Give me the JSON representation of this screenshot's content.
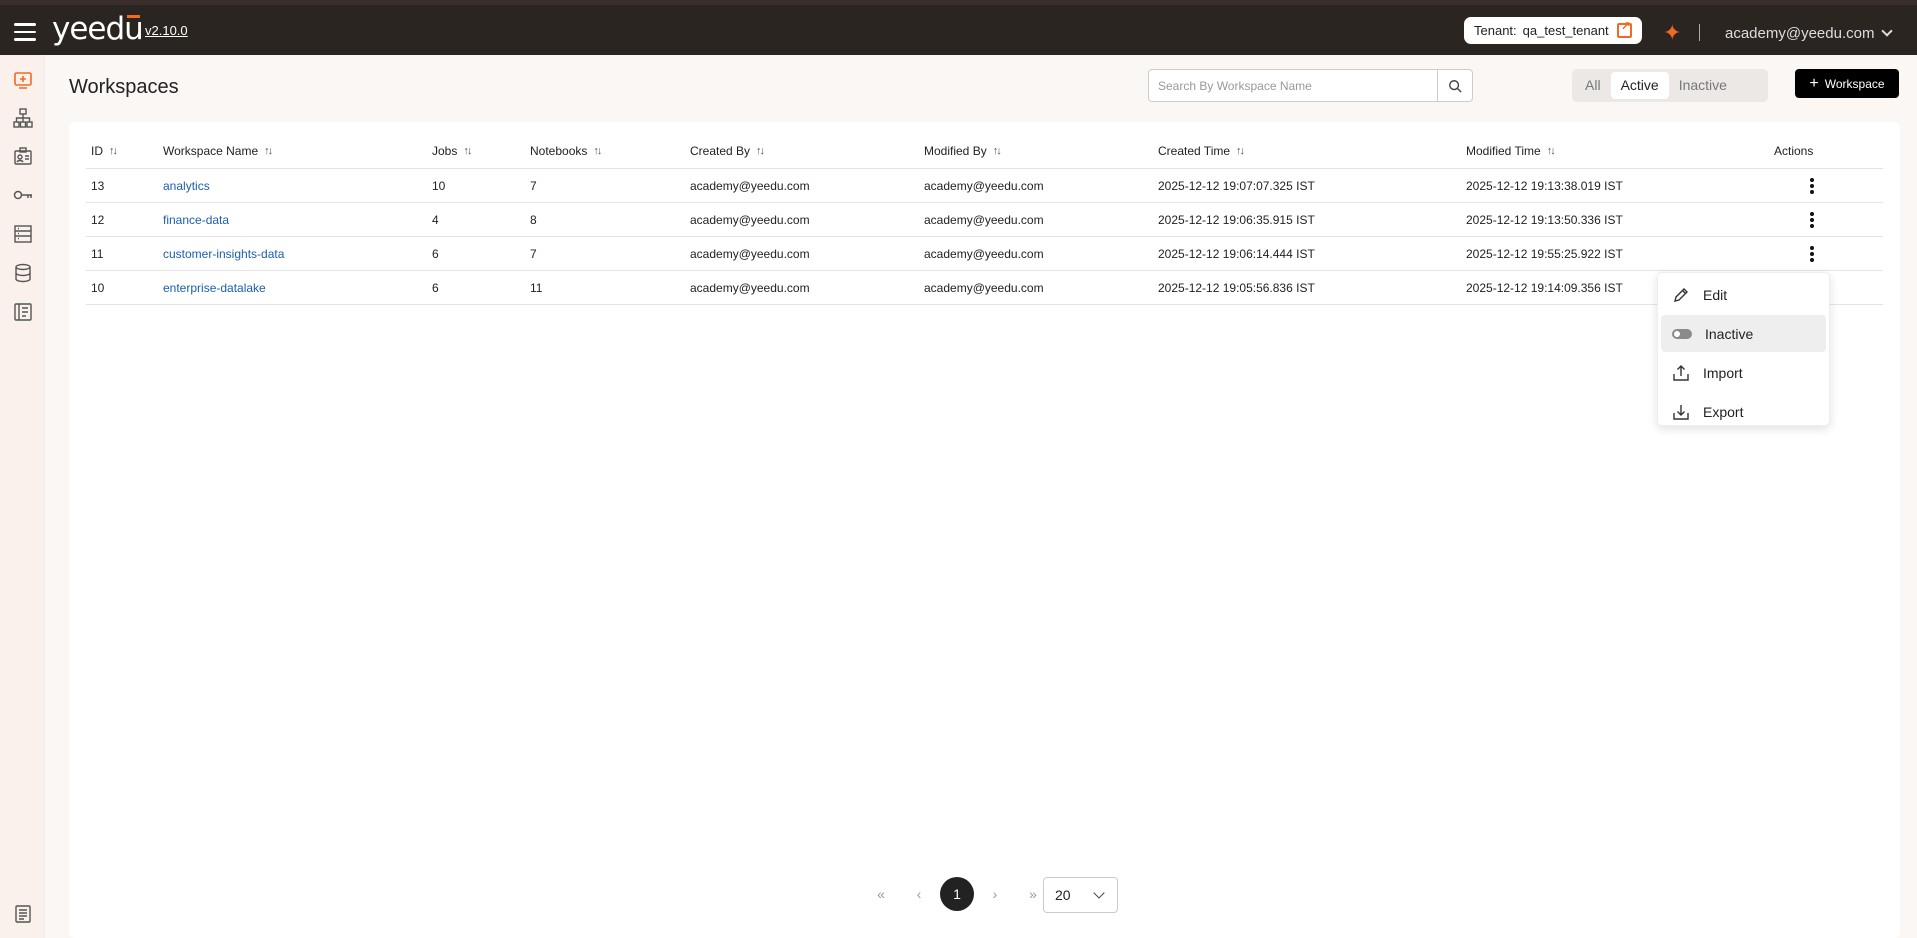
{
  "app": {
    "logo": "yeedu",
    "version": "v2.10.0",
    "tenant_label": "Tenant:",
    "tenant_value": "qa_test_tenant",
    "user_email": "academy@yeedu.com",
    "accent_color": "#f26a21"
  },
  "sidebar": {
    "items": [
      {
        "icon": "workspace-icon",
        "active": true
      },
      {
        "icon": "cluster-icon"
      },
      {
        "icon": "credentials-icon"
      },
      {
        "icon": "key-icon"
      },
      {
        "icon": "storage-icon"
      },
      {
        "icon": "database-icon"
      },
      {
        "icon": "billing-icon"
      },
      {
        "icon": "docs-icon"
      }
    ]
  },
  "page": {
    "title": "Workspaces",
    "search_placeholder": "Search By Workspace Name",
    "filters": [
      "All",
      "Active",
      "Inactive"
    ],
    "active_filter": "Active",
    "add_button": "Workspace"
  },
  "table": {
    "headers": [
      "ID",
      "Workspace Name",
      "Jobs",
      "Notebooks",
      "Created By",
      "Modified By",
      "Created Time",
      "Modified Time",
      "Actions"
    ],
    "rows": [
      {
        "id": "13",
        "name": "analytics",
        "jobs": "10",
        "notebooks": "7",
        "created_by": "academy@yeedu.com",
        "modified_by": "academy@yeedu.com",
        "created_time": "2025-12-12 19:07:07.325 IST",
        "modified_time": "2025-12-12 19:13:38.019 IST"
      },
      {
        "id": "12",
        "name": "finance-data",
        "jobs": "4",
        "notebooks": "8",
        "created_by": "academy@yeedu.com",
        "modified_by": "academy@yeedu.com",
        "created_time": "2025-12-12 19:06:35.915 IST",
        "modified_time": "2025-12-12 19:13:50.336 IST"
      },
      {
        "id": "11",
        "name": "customer-insights-data",
        "jobs": "6",
        "notebooks": "7",
        "created_by": "academy@yeedu.com",
        "modified_by": "academy@yeedu.com",
        "created_time": "2025-12-12 19:06:14.444 IST",
        "modified_time": "2025-12-12 19:55:25.922 IST"
      },
      {
        "id": "10",
        "name": "enterprise-datalake",
        "jobs": "6",
        "notebooks": "11",
        "created_by": "academy@yeedu.com",
        "modified_by": "academy@yeedu.com",
        "created_time": "2025-12-12 19:05:56.836 IST",
        "modified_time": "2025-12-12 19:14:09.356 IST"
      }
    ]
  },
  "action_menu": {
    "items": [
      "Edit",
      "Inactive",
      "Import",
      "Export"
    ],
    "highlighted": "Inactive"
  },
  "pagination": {
    "current_page": "1",
    "page_size": "20",
    "first": "«",
    "prev": "‹",
    "next": "›",
    "last": "»"
  }
}
